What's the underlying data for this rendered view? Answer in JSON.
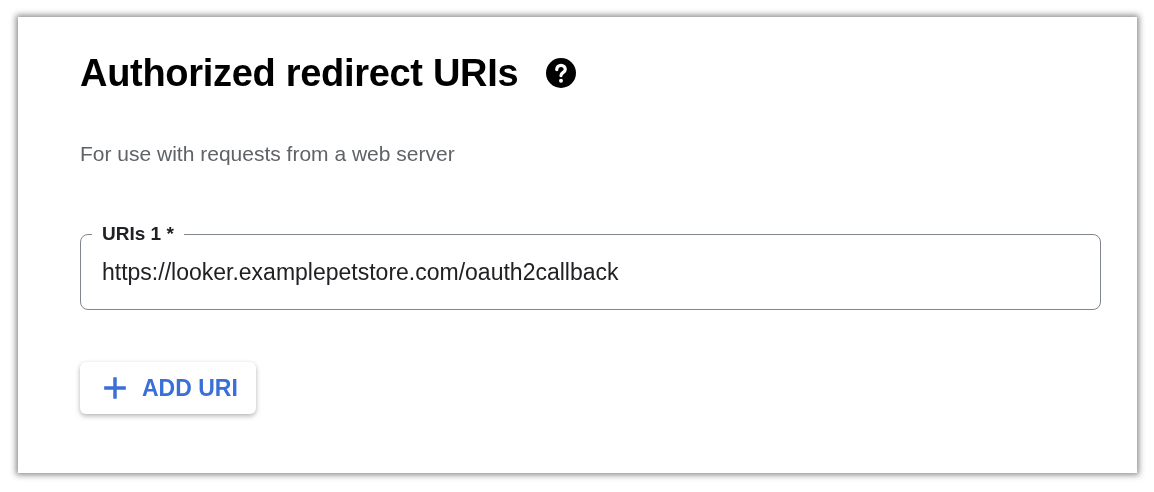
{
  "section": {
    "title": "Authorized redirect URIs",
    "description": "For use with requests from a web server"
  },
  "uri_fields": [
    {
      "label": "URIs 1 *",
      "value": "https://looker.examplepetstore.com/oauth2callback"
    }
  ],
  "add_button": {
    "label": "ADD URI"
  }
}
